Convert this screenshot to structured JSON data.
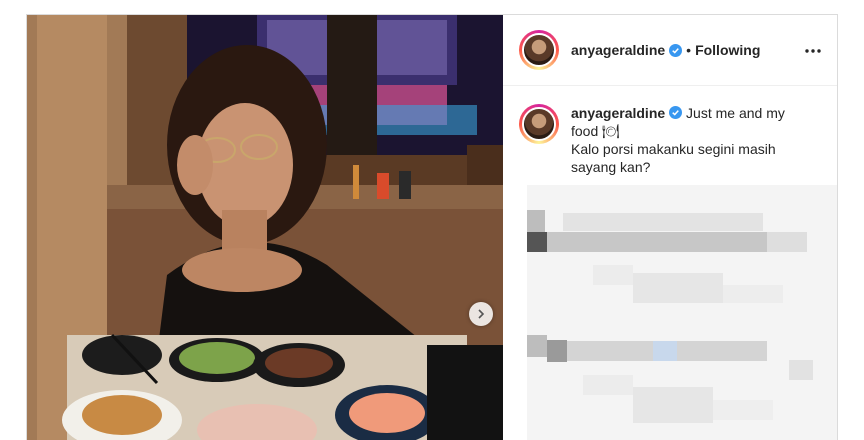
{
  "post": {
    "username": "anyageraldine",
    "follow_state": "Following",
    "separator": "•",
    "caption_line1": "Just me and my food 🍽",
    "caption_line2": "Kalo porsi makanku segini masih sayang kan?"
  },
  "icons": {
    "verified": "verified-badge-icon",
    "more": "more-options-icon",
    "next": "chevron-right-icon"
  },
  "colors": {
    "verified_blue": "#3897f0",
    "text": "#262626",
    "border": "#dbdbdb"
  }
}
